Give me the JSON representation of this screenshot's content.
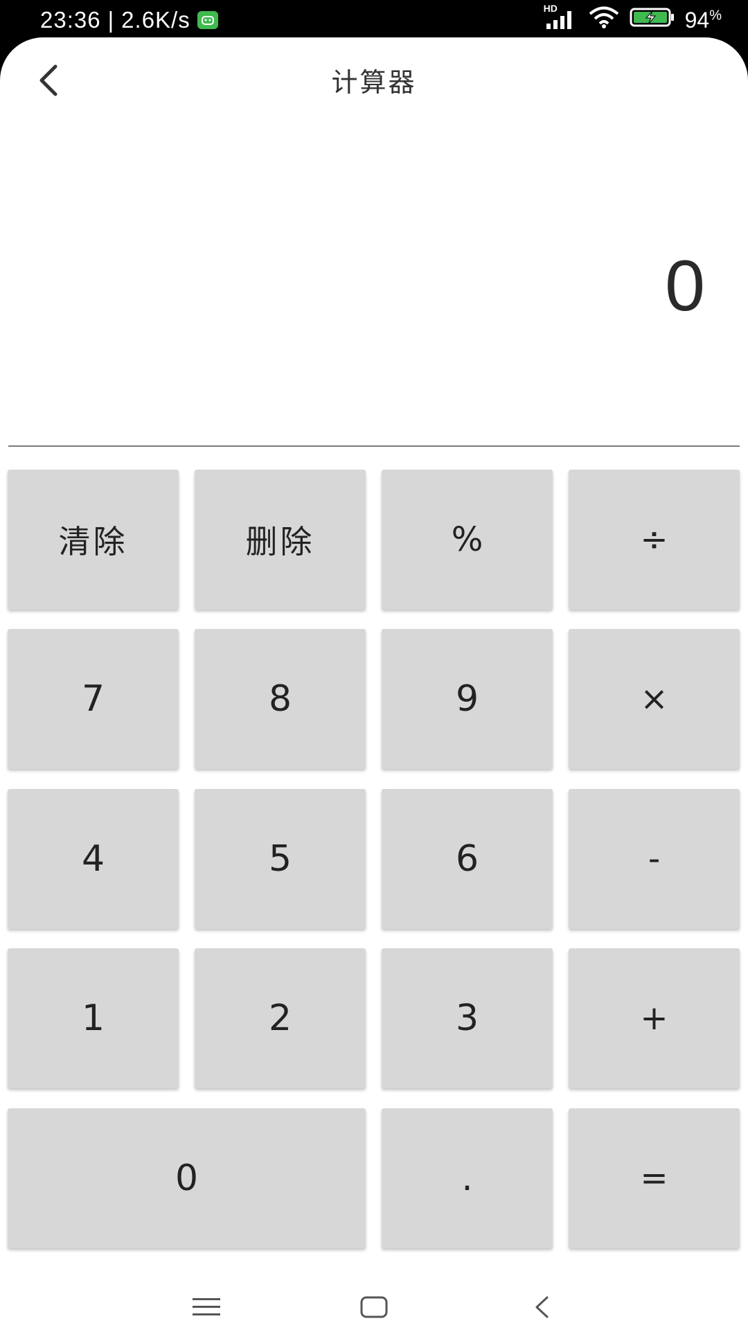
{
  "status_bar": {
    "time": "23:36",
    "network_speed": "2.6K/s",
    "signal_label": "HD",
    "battery_percent": "94",
    "battery_unit": "%"
  },
  "header": {
    "title": "计算器"
  },
  "display": {
    "value": "0"
  },
  "keypad": {
    "rows": [
      [
        "清除",
        "删除",
        "%",
        "÷"
      ],
      [
        "7",
        "8",
        "9",
        "×"
      ],
      [
        "4",
        "5",
        "6",
        "-"
      ],
      [
        "1",
        "2",
        "3",
        "+"
      ],
      [
        "0",
        ".",
        "="
      ]
    ]
  },
  "colors": {
    "key_background": "#d7d7d7",
    "text": "#222222",
    "app_background": "#ffffff",
    "status_background": "#000000",
    "badge": "#3fb950"
  }
}
